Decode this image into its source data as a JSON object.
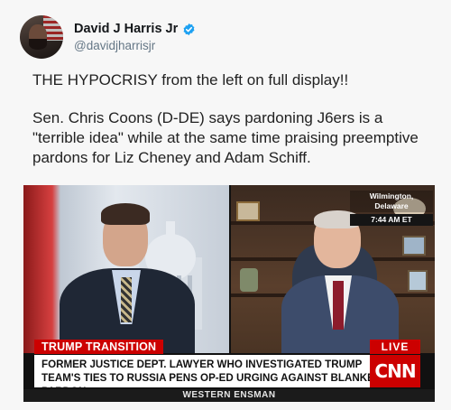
{
  "post": {
    "author_name": "David J Harris Jr",
    "handle": "@davidjharrisjr",
    "paragraph1": "THE HYPOCRISY from the left on full display!!",
    "paragraph2": "Sen. Chris Coons (D-DE) says pardoning J6ers is a \"terrible idea\" while at the same time praising preemptive pardons for Liz Cheney and Adam Schiff.",
    "verified_icon": "verified-badge-icon",
    "accent_color": "#1da1f2"
  },
  "video": {
    "location": "Wilmington, Delaware",
    "time": "7:44 AM ET",
    "section_label": "TRUMP TRANSITION",
    "live_label": "LIVE",
    "headline": "FORMER JUSTICE DEPT. LAWYER WHO INVESTIGATED TRUMP TEAM'S TIES TO RUSSIA PENS OP-ED URGING AGAINST BLANKET PARDON",
    "network_logo": "CNN",
    "ticker_text": "WESTERN ENSMAN",
    "brand_color": "#cc0000"
  }
}
